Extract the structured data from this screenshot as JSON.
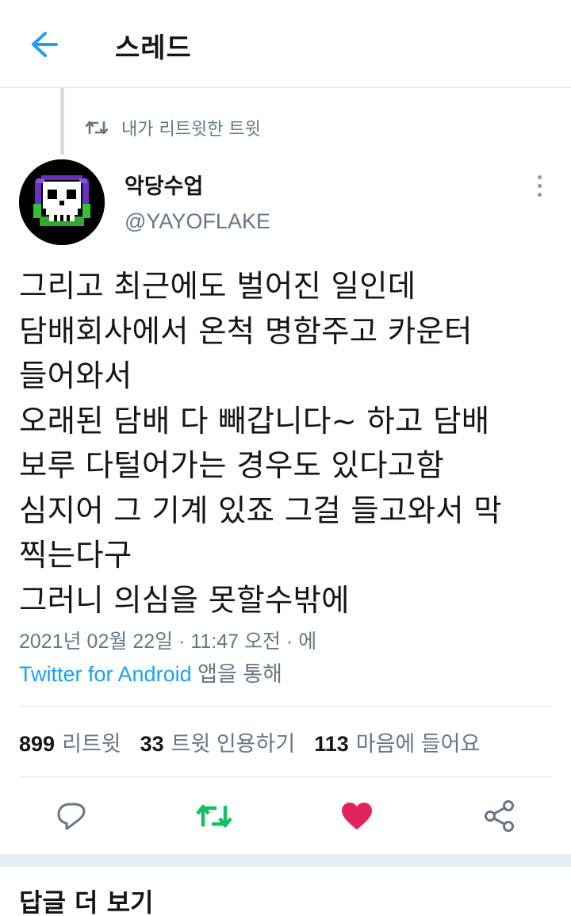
{
  "header": {
    "title": "스레드",
    "back_icon": "arrow-left-icon"
  },
  "retweet_context": {
    "label": "내가 리트윗한 트윗",
    "icon": "retweet-icon"
  },
  "tweet": {
    "author": {
      "display_name": "악당수업",
      "handle": "@YAYOFLAKE",
      "avatar": "skull-avatar"
    },
    "text": "그리고 최근에도 벌어진 일인데\n담배회사에서 온척 명함주고 카운터\n들어와서\n오래된 담배 다 빼갑니다~ 하고 담배\n보루 다털어가는 경우도 있다고함\n심지어 그 기계 있죠 그걸 들고와서 막\n찍는다구\n그러니 의심을 못할수밖에",
    "timestamp": "2021년 02월 22일 · 11:47 오전 · 에",
    "source_name": "Twitter for Android",
    "source_suffix": " 앱을 통해",
    "stats": [
      {
        "count": "899",
        "label": "리트윗"
      },
      {
        "count": "33",
        "label": "트윗 인용하기"
      },
      {
        "count": "113",
        "label": "마음에 들어요"
      }
    ],
    "actions": {
      "reply_icon": "reply-icon",
      "retweet_icon": "retweet-icon",
      "like_icon": "heart-icon",
      "share_icon": "share-icon"
    }
  },
  "more_replies": {
    "label": "답글 더 보기"
  },
  "colors": {
    "accent": "#1da1f2",
    "retweet_active": "#17bf63",
    "like_active": "#e0245e",
    "muted_text": "#657786",
    "avatar_ring": "#6a2fbf",
    "avatar_glow": "#35c035"
  }
}
